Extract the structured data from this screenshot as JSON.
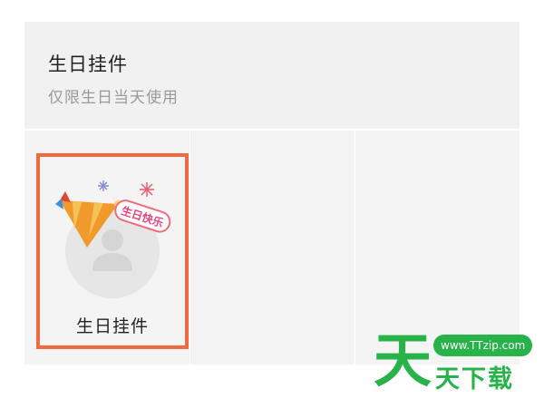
{
  "header": {
    "title": "生日挂件",
    "subtitle": "仅限生日当天使用"
  },
  "pendants": [
    {
      "label": "生日挂件",
      "badge_text": "生日快乐",
      "selected": true
    }
  ],
  "colors": {
    "selection_border": "#ef6a3f",
    "watermark_green": "#27b34a"
  },
  "watermark": {
    "url": "www.TTzip.com",
    "brand_text": "天下载",
    "logo_glyph": "天"
  }
}
